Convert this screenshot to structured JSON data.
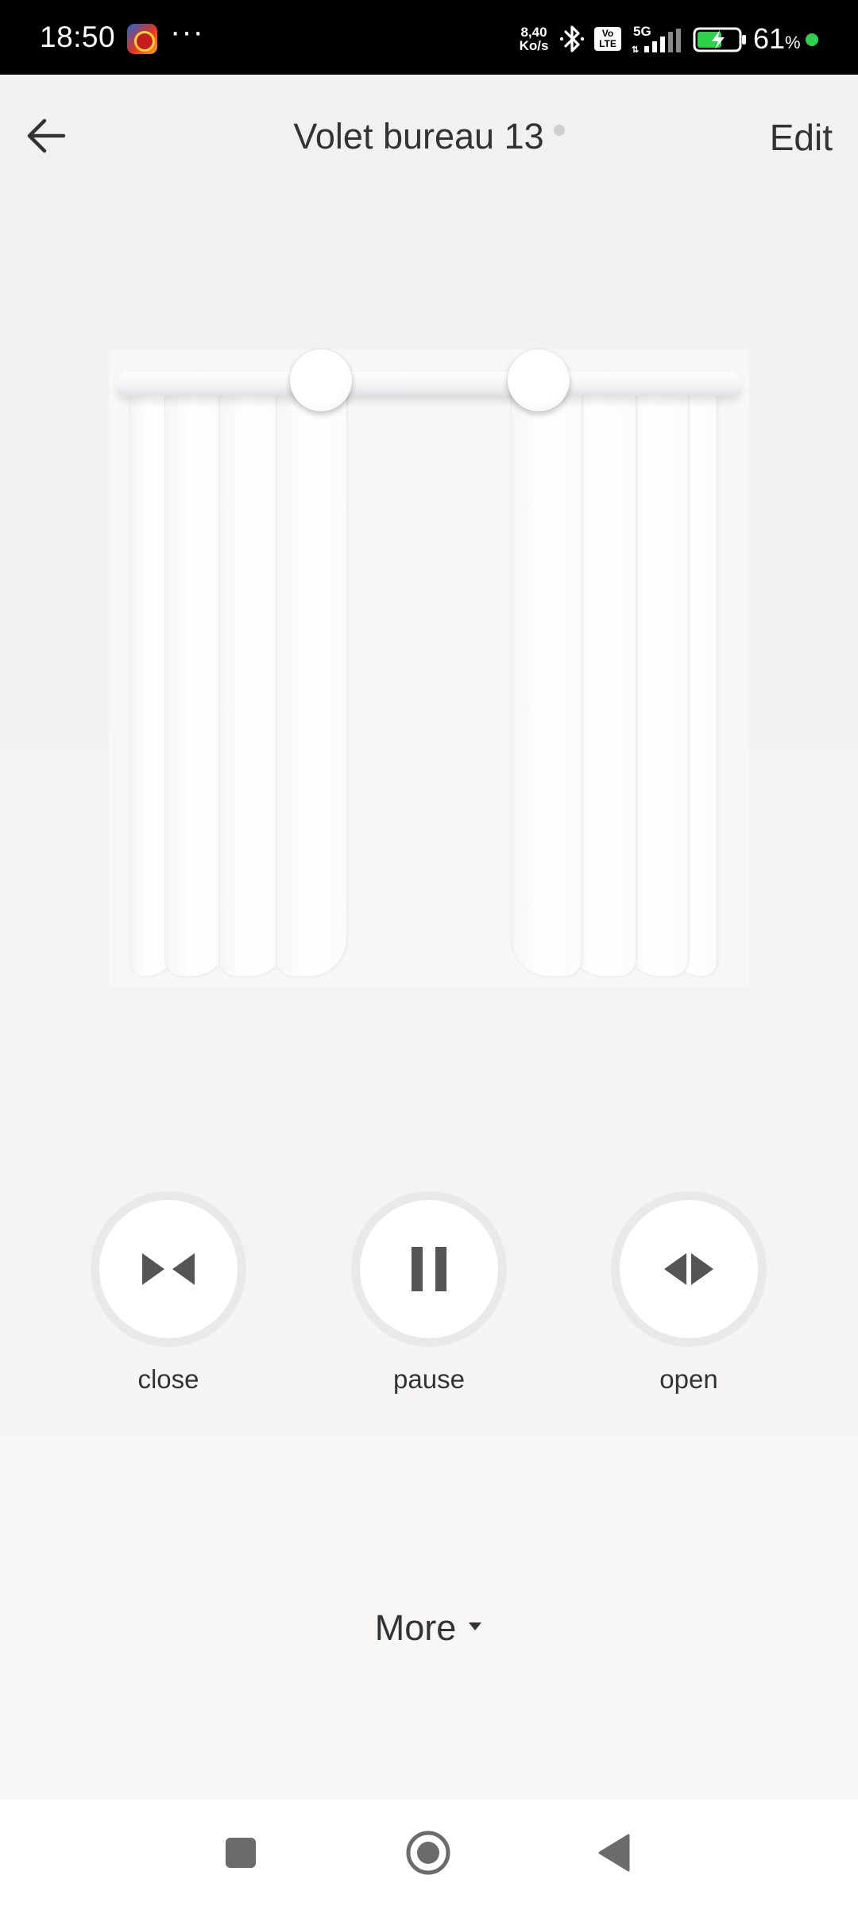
{
  "status_bar": {
    "time": "18:50",
    "dots": "···",
    "net_speed_value": "8,40",
    "net_speed_unit": "Ko/s",
    "volte_line1": "Vo",
    "volte_line2": "LTE",
    "network": "5G",
    "battery_percent": "61",
    "percent_sign": "%",
    "icons": [
      "app-icon",
      "bluetooth-icon",
      "volte-icon",
      "signal-icon",
      "battery-charging-icon"
    ],
    "dot_color": "#2ed24a"
  },
  "header": {
    "back_icon": "arrow-left-icon",
    "title": "Volet bureau 13",
    "edit_label": "Edit",
    "status_dot_color": "#cfcfcf"
  },
  "curtain": {
    "left_panel_folds": 4,
    "right_panel_folds": 4,
    "state": "partially open"
  },
  "controls": [
    {
      "id": "close",
      "label": "close",
      "icon": "close-curtain-icon"
    },
    {
      "id": "pause",
      "label": "pause",
      "icon": "pause-icon"
    },
    {
      "id": "open",
      "label": "open",
      "icon": "open-curtain-icon"
    }
  ],
  "more": {
    "label": "More",
    "icon": "caret-down-icon"
  },
  "navbar": {
    "icons": [
      "recents-square-icon",
      "home-circle-icon",
      "back-triangle-icon"
    ]
  },
  "colors": {
    "text": "#333333",
    "icon": "#555555",
    "ring": "#e9e9e9"
  }
}
